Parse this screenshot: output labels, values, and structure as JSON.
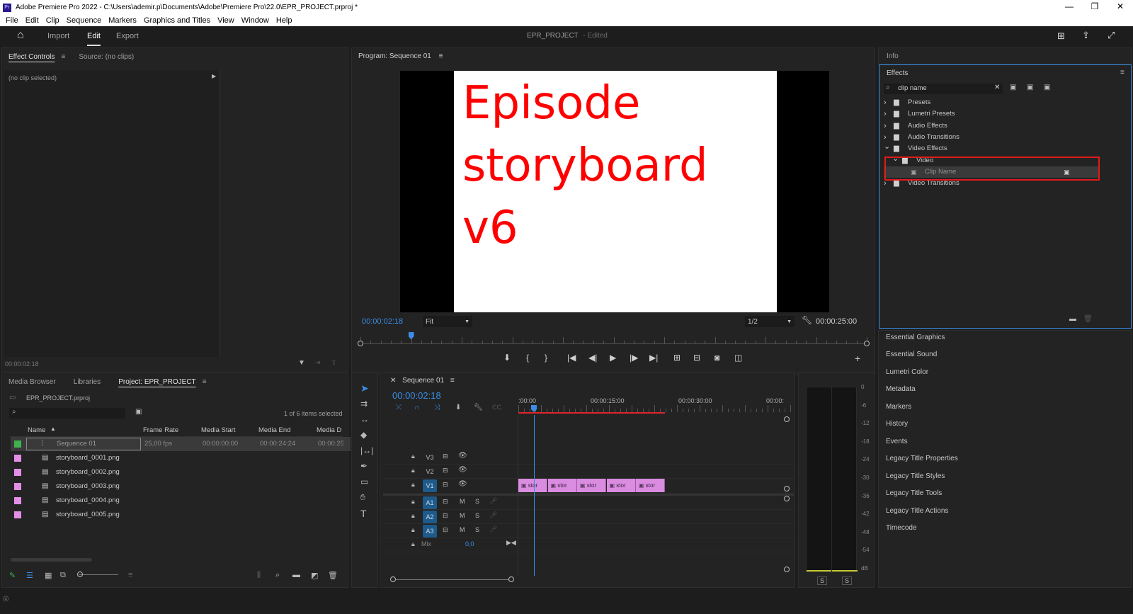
{
  "window": {
    "title": "Adobe Premiere Pro 2022 - C:\\Users\\ademir.p\\Documents\\Adobe\\Premiere Pro\\22.0\\EPR_PROJECT.prproj *",
    "app_icon": "Pr"
  },
  "menu": [
    "File",
    "Edit",
    "Clip",
    "Sequence",
    "Markers",
    "Graphics and Titles",
    "View",
    "Window",
    "Help"
  ],
  "header": {
    "tabs": [
      "Import",
      "Edit",
      "Export"
    ],
    "active_tab": "Edit",
    "project_name": "EPR_PROJECT",
    "edited_label": "- Edited"
  },
  "effect_controls": {
    "tab": "Effect Controls",
    "source_tab": "Source: (no clips)",
    "no_clip": "(no clip selected)",
    "timecode": "00:00:02:18"
  },
  "program": {
    "tab": "Program: Sequence 01",
    "frame_text": [
      "Episode",
      "storyboard",
      "v6"
    ],
    "timecode": "00:00:02:18",
    "fit": "Fit",
    "resolution": "1/2",
    "duration": "00:00:25:00",
    "playhead_fraction": 0.1,
    "frame_bg": "#ffffff",
    "frame_text_color": "#ff0000"
  },
  "project": {
    "tabs": [
      "Media Browser",
      "Libraries",
      "Project: EPR_PROJECT"
    ],
    "file": "EPR_PROJECT.prproj",
    "selected_count": "1 of 6 items selected",
    "columns": [
      "Name",
      "Frame Rate",
      "Media Start",
      "Media End",
      "Media D"
    ],
    "rows": [
      {
        "name": "Sequence 01",
        "frame_rate": "25,00 fps",
        "start": "00:00:00:00",
        "end": "00:00:24:24",
        "dur": "00:00:25",
        "color": "#3fb24d"
      },
      {
        "name": "storyboard_0001.png",
        "frame_rate": "",
        "start": "",
        "end": "",
        "dur": "",
        "color": "#e48ee8"
      },
      {
        "name": "storyboard_0002.png",
        "frame_rate": "",
        "start": "",
        "end": "",
        "dur": "",
        "color": "#e48ee8"
      },
      {
        "name": "storyboard_0003.png",
        "frame_rate": "",
        "start": "",
        "end": "",
        "dur": "",
        "color": "#e48ee8"
      },
      {
        "name": "storyboard_0004.png",
        "frame_rate": "",
        "start": "",
        "end": "",
        "dur": "",
        "color": "#e48ee8"
      },
      {
        "name": "storyboard_0005.png",
        "frame_rate": "",
        "start": "",
        "end": "",
        "dur": "",
        "color": "#e48ee8"
      }
    ]
  },
  "timeline": {
    "tab": "Sequence 01",
    "timecode": "00:00:02:18",
    "ruler": [
      ":00:00",
      "00:00:15:00",
      "00:00:30:00",
      "00:00:"
    ],
    "tracks": [
      "V3",
      "V2",
      "V1",
      "A1",
      "A2",
      "A3"
    ],
    "mix_label": "Mix",
    "mix_value": "0,0",
    "mute": "M",
    "solo": "S",
    "clip_label": "stor",
    "clip_count": 5
  },
  "meter": {
    "scale": [
      "0",
      "-6",
      "-12",
      "-18",
      "-24",
      "-30",
      "-36",
      "-42",
      "-48",
      "-54",
      "dB"
    ],
    "solo": [
      "S",
      "S"
    ]
  },
  "info": {
    "tab": "Info"
  },
  "effects": {
    "tab": "Effects",
    "search_value": "clip name",
    "tree": [
      {
        "label": "Presets",
        "level": 0,
        "open": false
      },
      {
        "label": "Lumetri Presets",
        "level": 0,
        "open": false
      },
      {
        "label": "Audio Effects",
        "level": 0,
        "open": false
      },
      {
        "label": "Audio Transitions",
        "level": 0,
        "open": false
      },
      {
        "label": "Video Effects",
        "level": 0,
        "open": true
      },
      {
        "label": "Video",
        "level": 1,
        "open": true
      },
      {
        "label": "Clip Name",
        "level": 2,
        "open": false
      },
      {
        "label": "Video Transitions",
        "level": 0,
        "open": false
      }
    ],
    "highlight_color": "#e01b1b"
  },
  "right_panels": [
    "Essential Graphics",
    "Essential Sound",
    "Lumetri Color",
    "Metadata",
    "Markers",
    "History",
    "Events",
    "Legacy Title Properties",
    "Legacy Title Styles",
    "Legacy Title Tools",
    "Legacy Title Actions",
    "Timecode"
  ]
}
